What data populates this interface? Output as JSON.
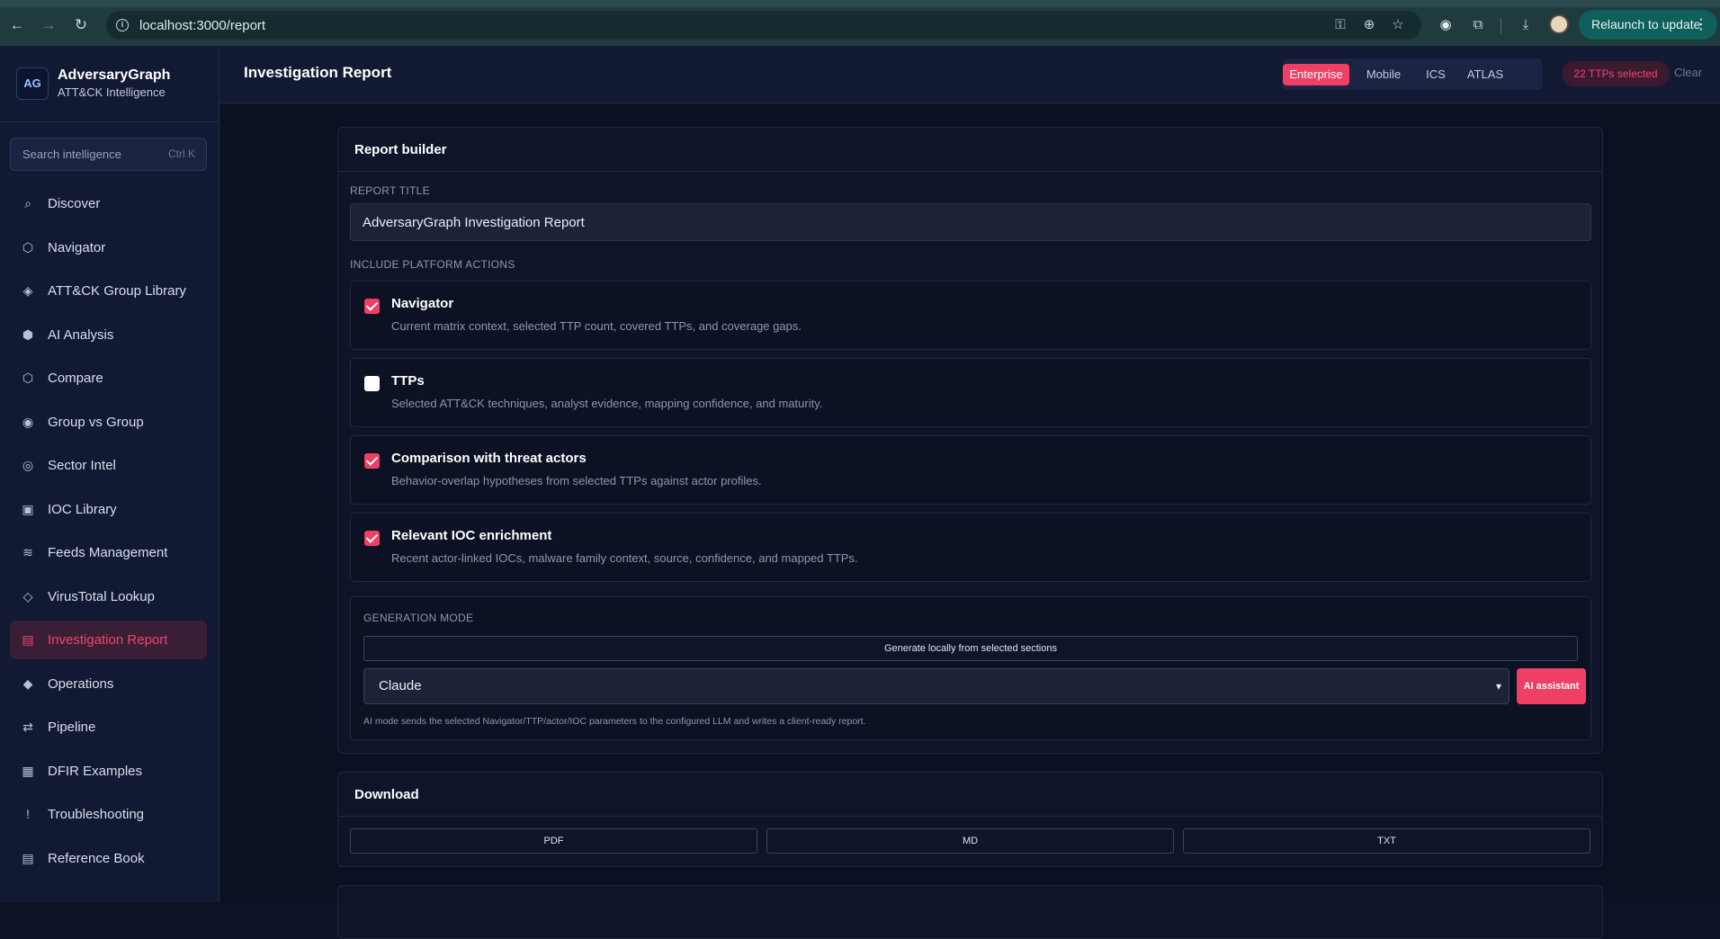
{
  "browser": {
    "url": "localhost:3000/report",
    "relaunch_label": "Relaunch to update"
  },
  "sidebar": {
    "brand_name": "AdversaryGraph",
    "brand_tagline": "ATT&CK Intelligence",
    "logo_text": "AG",
    "search_placeholder": "Search intelligence",
    "search_shortcut": "Ctrl K",
    "items": [
      {
        "label": "Discover",
        "icon": "⌕"
      },
      {
        "label": "Navigator",
        "icon": "⬡"
      },
      {
        "label": "ATT&CK Group Library",
        "icon": "◈"
      },
      {
        "label": "AI Analysis",
        "icon": "⬢"
      },
      {
        "label": "Compare",
        "icon": "⬡"
      },
      {
        "label": "Group vs Group",
        "icon": "◉"
      },
      {
        "label": "Sector Intel",
        "icon": "◎"
      },
      {
        "label": "IOC Library",
        "icon": "▣"
      },
      {
        "label": "Feeds Management",
        "icon": "≋"
      },
      {
        "label": "VirusTotal Lookup",
        "icon": "◇"
      },
      {
        "label": "Investigation Report",
        "icon": "▤"
      },
      {
        "label": "Operations",
        "icon": "◆"
      },
      {
        "label": "Pipeline",
        "icon": "⇄"
      },
      {
        "label": "DFIR Examples",
        "icon": "▦"
      },
      {
        "label": "Troubleshooting",
        "icon": "!"
      },
      {
        "label": "Reference Book",
        "icon": "▤"
      }
    ],
    "active_index": 10
  },
  "header": {
    "title": "Investigation Report",
    "domains": [
      "Enterprise",
      "Mobile",
      "ICS",
      "ATLAS"
    ],
    "active_domain": "Enterprise",
    "ttp_badge": "22 TTPs selected",
    "clear_label": "Clear"
  },
  "report_builder": {
    "card_title": "Report builder",
    "report_title_label": "REPORT TITLE",
    "report_title_value": "AdversaryGraph Investigation Report",
    "include_label": "INCLUDE PLATFORM ACTIONS",
    "options": [
      {
        "title": "Navigator",
        "description": "Current matrix context, selected TTP count, covered TTPs, and coverage gaps.",
        "checked": true
      },
      {
        "title": "TTPs",
        "description": "Selected ATT&CK techniques, analyst evidence, mapping confidence, and maturity.",
        "checked": false
      },
      {
        "title": "Comparison with threat actors",
        "description": "Behavior-overlap hypotheses from selected TTPs against actor profiles.",
        "checked": true
      },
      {
        "title": "Relevant IOC enrichment",
        "description": "Recent actor-linked IOCs, malware family context, source, confidence, and mapped TTPs.",
        "checked": true
      }
    ],
    "generation_mode_label": "GENERATION MODE",
    "generate_local_label": "Generate locally from selected sections",
    "model_selected": "Claude",
    "ai_assistant_label": "AI assistant",
    "ai_note": "AI mode sends the selected Navigator/TTP/actor/IOC parameters to the configured LLM and writes a client-ready report."
  },
  "download": {
    "card_title": "Download",
    "formats": [
      "PDF",
      "MD",
      "TXT"
    ]
  }
}
